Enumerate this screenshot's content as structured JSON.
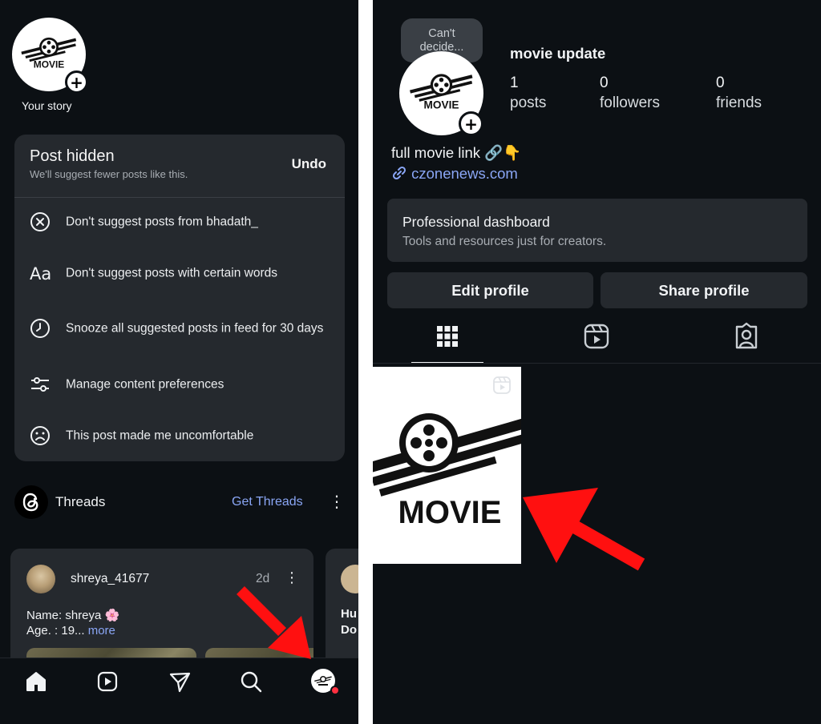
{
  "colors": {
    "background": "#0c1014",
    "card": "#25292e",
    "link_blue": "#8aa6f5",
    "arrow_red": "#ff1010",
    "notification_red": "#ff3040"
  },
  "logo": {
    "text": "MOVIE"
  },
  "left": {
    "story": {
      "caption": "Your story",
      "add_icon": "plus-icon"
    },
    "post_hidden_menu": {
      "title": "Post hidden",
      "subtitle": "We'll suggest fewer posts like this.",
      "undo_label": "Undo",
      "items": [
        {
          "icon": "circle-x-icon",
          "label": "Don't suggest posts from bhadath_"
        },
        {
          "icon": "text-aa-icon",
          "label": "Don't suggest posts with certain words"
        },
        {
          "icon": "clock-icon",
          "label": "Snooze all suggested posts in feed for 30 days"
        },
        {
          "icon": "sliders-icon",
          "label": "Manage content preferences"
        },
        {
          "icon": "sad-face-icon",
          "label": "This post made me uncomfortable"
        }
      ]
    },
    "threads": {
      "label": "Threads",
      "cta": "Get Threads",
      "more_icon": "⋮"
    },
    "thread_post": {
      "username": "shreya_41677",
      "time": "2d",
      "more_icon": "⋮",
      "line1": "Name: shreya 🌸",
      "line2": "Age. : 19...",
      "more_link": "more"
    },
    "thread_post_2": {
      "text_line1": "Hu",
      "text_line2": "Do"
    },
    "bottom_nav": [
      "home-icon",
      "reels-icon",
      "send-icon",
      "search-icon",
      "profile-avatar"
    ]
  },
  "right": {
    "tooltip": {
      "line1": "Can't",
      "line2": "decide..."
    },
    "profile": {
      "name": "movie update",
      "stats": [
        {
          "value": "1",
          "label": "posts"
        },
        {
          "value": "0",
          "label": "followers"
        },
        {
          "value": "0",
          "label": "friends"
        }
      ],
      "bio": "full movie link 🔗👇",
      "link": "czonenews.com"
    },
    "dashboard": {
      "title": "Professional dashboard",
      "subtitle": "Tools and resources just for creators."
    },
    "buttons": {
      "edit": "Edit profile",
      "share": "Share profile"
    },
    "tabs": [
      "grid-icon",
      "reels-icon",
      "tagged-icon"
    ],
    "post": {
      "text": "MOVIE",
      "badge": "reels-icon"
    }
  }
}
